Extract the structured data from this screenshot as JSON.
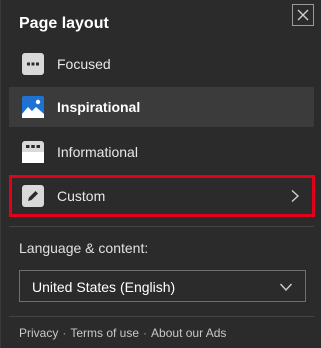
{
  "panel": {
    "title": "Page layout",
    "close_icon": "close-icon"
  },
  "layout_options": [
    {
      "label": "Focused",
      "icon": "focused-layout-icon",
      "selected": false
    },
    {
      "label": "Inspirational",
      "icon": "inspirational-layout-icon",
      "selected": true
    },
    {
      "label": "Informational",
      "icon": "informational-layout-icon",
      "selected": false
    },
    {
      "label": "Custom",
      "icon": "pencil-icon",
      "selected": false,
      "highlighted": true
    }
  ],
  "language": {
    "section_label": "Language & content:",
    "selected_value": "United States (English)"
  },
  "footer": {
    "links": [
      "Privacy",
      "Terms of use",
      "About our Ads"
    ],
    "separator": "·"
  },
  "colors": {
    "background": "#2b2b2b",
    "selected_row": "#3b3b3b",
    "highlight_border": "#e3001b",
    "accent_blue": "#1e73d2"
  }
}
